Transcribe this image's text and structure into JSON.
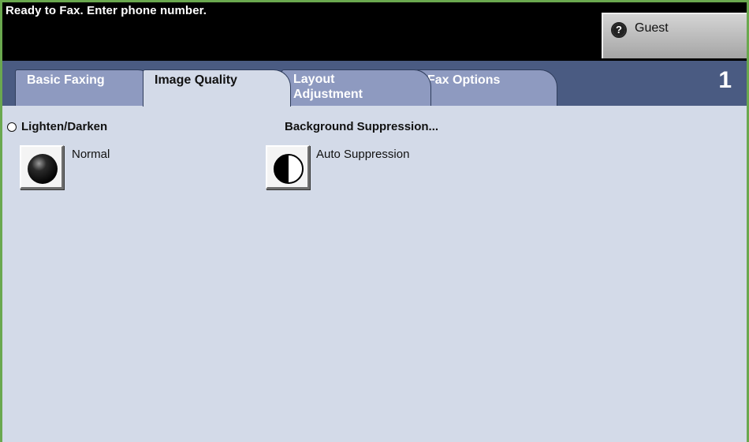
{
  "header": {
    "status": "Ready to Fax. Enter phone number.",
    "user_label": "Guest",
    "user_icon_glyph": "?"
  },
  "tabs": [
    {
      "label_lines": [
        "Basic Faxing"
      ],
      "active": false
    },
    {
      "label_lines": [
        "Image Quality"
      ],
      "active": true
    },
    {
      "label_lines": [
        "Layout",
        "Adjustment"
      ],
      "active": false
    },
    {
      "label_lines": [
        "Fax Options"
      ],
      "active": false
    }
  ],
  "page_number": "1",
  "lighten_darken": {
    "heading": "Lighten/Darken",
    "value": "Normal",
    "icon": "dark-sphere-icon"
  },
  "background_suppression": {
    "heading": "Background Suppression...",
    "value": "Auto Suppression",
    "icon": "half-contrast-icon"
  },
  "colors": {
    "frame": "#6aa84f",
    "tabbar": "#4a5b82",
    "tab_inactive": "#8e9ac0",
    "content_bg": "#d3dae8"
  }
}
